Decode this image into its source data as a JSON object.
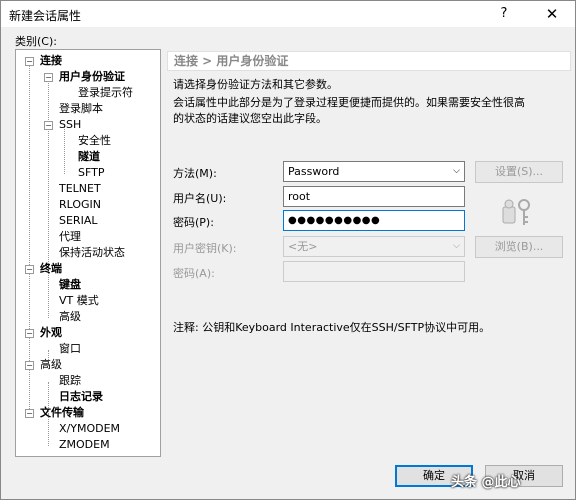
{
  "window": {
    "title": "新建会话属性",
    "help_glyph": "?",
    "close_glyph": "✕"
  },
  "category_label": "类别(C):",
  "tree": {
    "connection": "连接",
    "user_auth": "用户身份验证",
    "login_prompt": "登录提示符",
    "login_script": "登录脚本",
    "ssh": "SSH",
    "security": "安全性",
    "tunnel": "隧道",
    "sftp": "SFTP",
    "telnet": "TELNET",
    "rlogin": "RLOGIN",
    "serial": "SERIAL",
    "proxy": "代理",
    "keepalive": "保持活动状态",
    "terminal": "终端",
    "keyboard": "键盘",
    "vt_mode": "VT 模式",
    "advanced1": "高级",
    "appearance": "外观",
    "window": "窗口",
    "advanced2": "高级",
    "trace": "跟踪",
    "logging": "日志记录",
    "file_transfer": "文件传输",
    "xymodem": "X/YMODEM",
    "zmodem": "ZMODEM"
  },
  "panel": {
    "breadcrumb": "连接 > 用户身份验证",
    "desc1": "请选择身份验证方法和其它参数。",
    "desc2": "会话属性中此部分是为了登录过程更便捷而提供的。如果需要安全性很高",
    "desc3": "的状态的话建议您空出此字段。"
  },
  "form": {
    "method_label": "方法(M):",
    "method_value": "Password",
    "setup_button": "设置(S)...",
    "username_label": "用户名(U):",
    "username_value": "root",
    "password_label": "密码(P):",
    "password_value": "●●●●●●●●●●",
    "user_key_label": "用户密钥(K):",
    "user_key_value": "<无>",
    "browse_button": "浏览(B)...",
    "passphrase_label": "密码(A):",
    "passphrase_value": ""
  },
  "note": "注释: 公钥和Keyboard Interactive仅在SSH/SFTP协议中可用。",
  "buttons": {
    "ok": "确定",
    "cancel": "取消"
  },
  "watermark": "头条 @此心"
}
